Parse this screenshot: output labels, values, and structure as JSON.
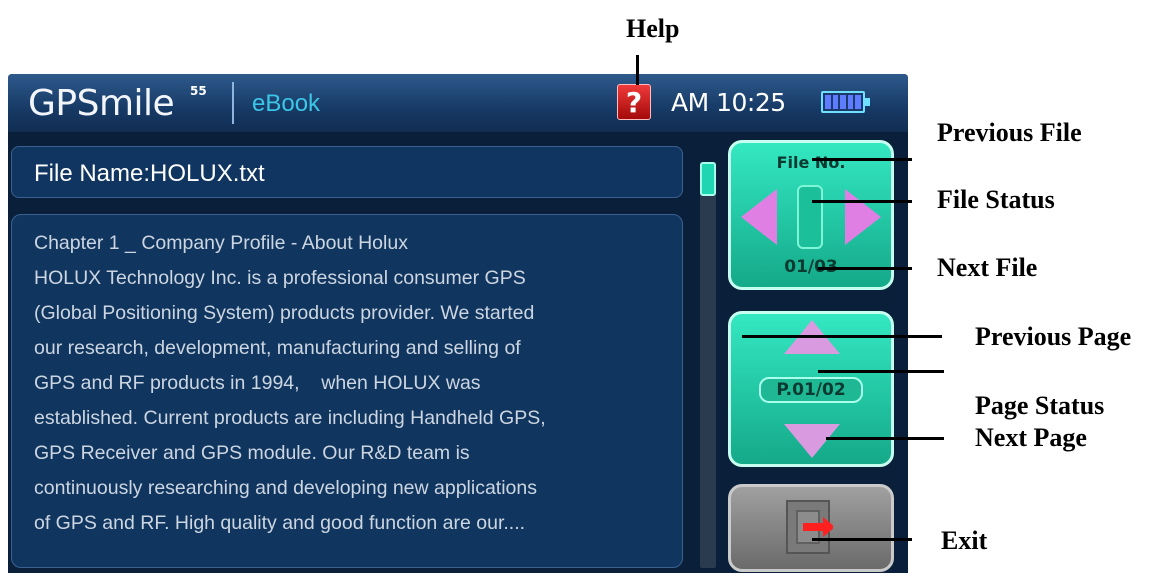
{
  "app": {
    "logo": "GPSmile",
    "logo_superscript": "55",
    "app_name": "eBook",
    "help_glyph": "?",
    "clock": "AM 10:25",
    "battery_icon": "battery-full-icon"
  },
  "reader": {
    "file_name": "File Name:HOLUX.txt",
    "text_lines": [
      "Chapter 1 _ Company Profile - About Holux",
      "HOLUX Technology Inc. is a professional consumer GPS",
      "(Global Positioning System) products provider. We started",
      "our research, development, manufacturing and selling of",
      "GPS and RF products in 1994,    when HOLUX was",
      "established. Current products are including Handheld GPS,",
      "GPS Receiver and GPS module. Our R&D team is",
      "continuously researching and developing new applications",
      "of GPS and RF. High quality and good function are our...."
    ]
  },
  "controls": {
    "file_no_label": "File No.",
    "file_count": "01/03",
    "page_status": "P.01/02"
  },
  "callouts": {
    "help": "Help",
    "previous_file": "Previous File",
    "file_status": "File Status",
    "next_file": "Next File",
    "previous_page": "Previous Page",
    "page_status": "Page Status",
    "next_page": "Next Page",
    "exit": "Exit"
  },
  "colors": {
    "title_bar": "#173a66",
    "panel": "#103660",
    "control_green": "#34e8c2",
    "arrow_pink": "#e07fe3",
    "help_red": "#d11a1a"
  }
}
